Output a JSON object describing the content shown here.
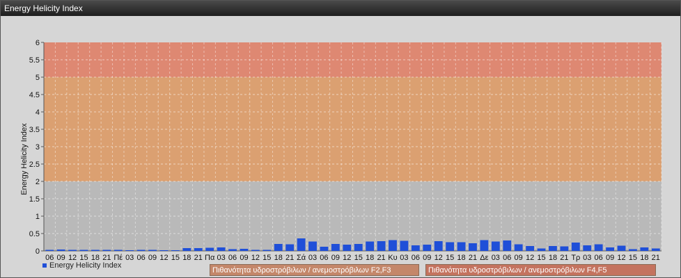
{
  "window": {
    "title": "Energy Helicity Index"
  },
  "colors": {
    "bar": "#1f4fd8",
    "zone_low": "#b9b9b9",
    "zone_mid": "#dba071",
    "zone_high": "#de8872",
    "badge1": "#c4876a",
    "badge2": "#c4735f"
  },
  "legend": {
    "label": "Energy Helicity Index"
  },
  "badges": [
    {
      "label": "Πιθανότητα υδροστρόβιλων / ανεμοστρόβιλων F2,F3"
    },
    {
      "label": "Πιθανότητα υδροστρόβιλων / ανεμοστρόβιλων F4,F5"
    }
  ],
  "chart_data": {
    "type": "bar",
    "ylabel": "Energy Helicity Index",
    "ylim": [
      0,
      6
    ],
    "yticks": [
      "0",
      "0.5",
      "1",
      "1.5",
      "2",
      "2.5",
      "3",
      "3.5",
      "4",
      "4.5",
      "5",
      "5.5",
      "6"
    ],
    "zones": [
      {
        "from": 0,
        "to": 2
      },
      {
        "from": 2,
        "to": 5
      },
      {
        "from": 5,
        "to": 6
      }
    ],
    "grid": true,
    "categories": [
      "06",
      "09",
      "12",
      "15",
      "18",
      "21",
      "Πέ",
      "03",
      "06",
      "09",
      "12",
      "15",
      "18",
      "21",
      "Πα",
      "03",
      "06",
      "09",
      "12",
      "15",
      "18",
      "21",
      "Σά",
      "03",
      "06",
      "09",
      "12",
      "15",
      "18",
      "21",
      "Κυ",
      "03",
      "06",
      "09",
      "12",
      "15",
      "18",
      "21",
      "Δε",
      "03",
      "06",
      "09",
      "12",
      "15",
      "18",
      "21",
      "Τρ",
      "03",
      "06",
      "09",
      "12",
      "15",
      "18",
      "21"
    ],
    "values": [
      0.03,
      0.04,
      0.03,
      0.03,
      0.03,
      0.03,
      0.03,
      0.02,
      0.03,
      0.03,
      0.02,
      0.02,
      0.08,
      0.08,
      0.09,
      0.1,
      0.05,
      0.06,
      0.03,
      0.03,
      0.2,
      0.19,
      0.36,
      0.27,
      0.12,
      0.2,
      0.18,
      0.2,
      0.27,
      0.28,
      0.31,
      0.29,
      0.16,
      0.18,
      0.28,
      0.25,
      0.25,
      0.22,
      0.31,
      0.27,
      0.3,
      0.19,
      0.14,
      0.07,
      0.14,
      0.13,
      0.24,
      0.16,
      0.19,
      0.1,
      0.15,
      0.05,
      0.1,
      0.07
    ]
  }
}
